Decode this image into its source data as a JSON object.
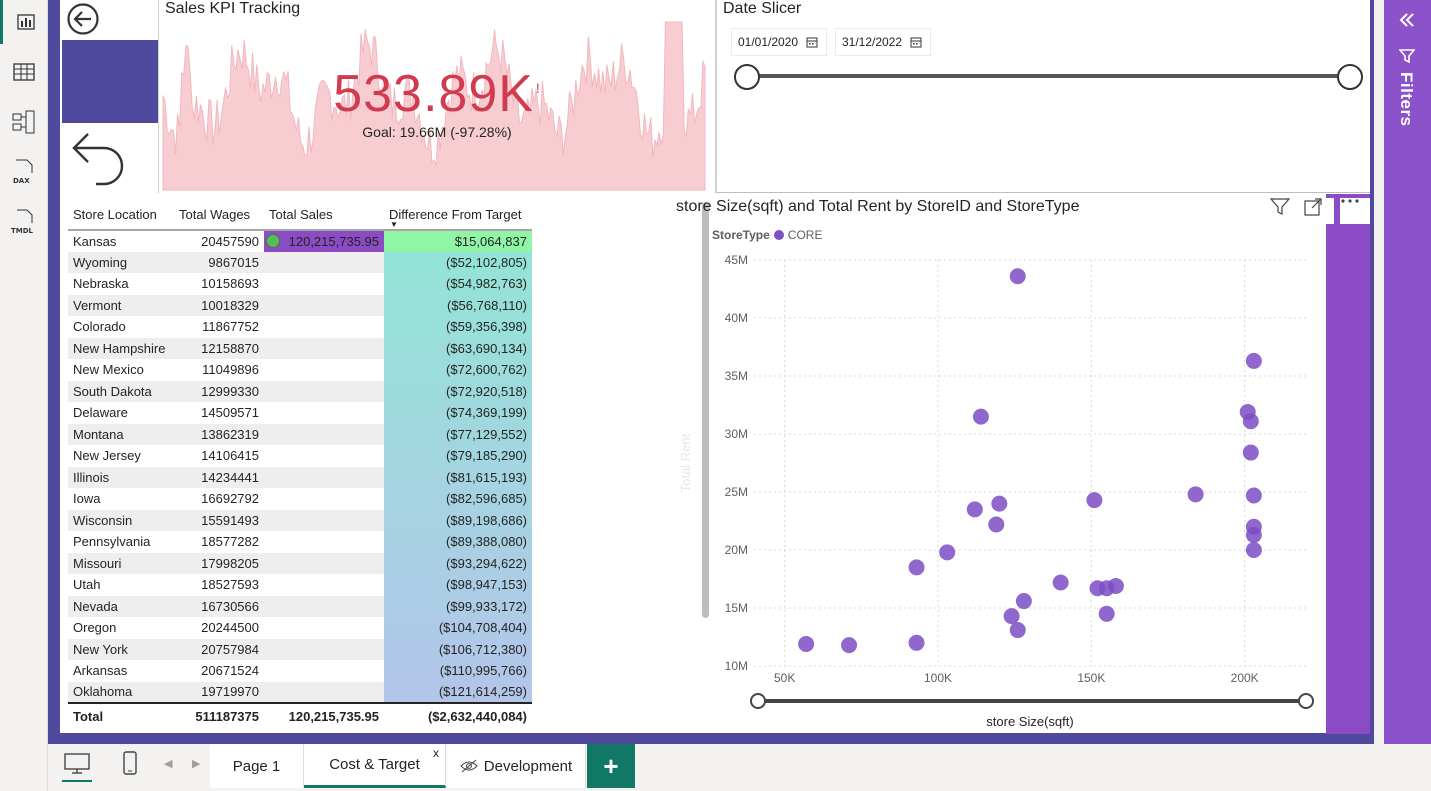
{
  "nav": {
    "left_icons": [
      "report-view-icon",
      "table-view-icon",
      "model-view-icon",
      "dax-query-icon",
      "tmdl-view-icon"
    ],
    "dax_label": "DAX",
    "tmdl_label": "TMDL"
  },
  "kpi": {
    "title": "Sales KPI Tracking",
    "value": "533.89K",
    "alert": "!",
    "goal": "Goal: 19.66M (-97.28%)",
    "value_color": "#d13b50"
  },
  "slicer": {
    "title": "Date Slicer",
    "start_date": "01/01/2020",
    "end_date": "31/12/2022"
  },
  "table": {
    "headers": [
      "Store Location",
      "Total Wages",
      "Total Sales",
      "Difference From Target"
    ],
    "rows": [
      [
        "Kansas",
        "20457590",
        "120,215,735.95",
        "$15,064,837"
      ],
      [
        "Wyoming",
        "9867015",
        "",
        "($52,102,805)"
      ],
      [
        "Nebraska",
        "10158693",
        "",
        "($54,982,763)"
      ],
      [
        "Vermont",
        "10018329",
        "",
        "($56,768,110)"
      ],
      [
        "Colorado",
        "11867752",
        "",
        "($59,356,398)"
      ],
      [
        "New Hampshire",
        "12158870",
        "",
        "($63,690,134)"
      ],
      [
        "New Mexico",
        "11049896",
        "",
        "($72,600,762)"
      ],
      [
        "South Dakota",
        "12999330",
        "",
        "($72,920,518)"
      ],
      [
        "Delaware",
        "14509571",
        "",
        "($74,369,199)"
      ],
      [
        "Montana",
        "13862319",
        "",
        "($77,129,552)"
      ],
      [
        "New Jersey",
        "14106415",
        "",
        "($79,185,290)"
      ],
      [
        "Illinois",
        "14234441",
        "",
        "($81,615,193)"
      ],
      [
        "Iowa",
        "16692792",
        "",
        "($82,596,685)"
      ],
      [
        "Wisconsin",
        "15591493",
        "",
        "($89,198,686)"
      ],
      [
        "Pennsylvania",
        "18577282",
        "",
        "($89,388,080)"
      ],
      [
        "Missouri",
        "17998205",
        "",
        "($93,294,622)"
      ],
      [
        "Utah",
        "18527593",
        "",
        "($98,947,153)"
      ],
      [
        "Nevada",
        "16730566",
        "",
        "($99,933,172)"
      ],
      [
        "Oregon",
        "20244500",
        "",
        "($104,708,404)"
      ],
      [
        "New York",
        "20757984",
        "",
        "($106,712,380)"
      ],
      [
        "Arkansas",
        "20671524",
        "",
        "($110,995,766)"
      ],
      [
        "Oklahoma",
        "19719970",
        "",
        "($121,614,259)"
      ]
    ],
    "total": [
      "Total",
      "511187375",
      "120,215,735.95",
      "($2,632,440,084)"
    ],
    "positive_color": "#90f5a6",
    "gradient_start": "#94e3d7",
    "gradient_end": "#b3c6ea",
    "bar_color": "#8a4bc4"
  },
  "scatter": {
    "title": "store Size(sqft) and Total Rent by StoreID and StoreType",
    "legend_title": "StoreType",
    "legend_item": "CORE",
    "point_color": "#7d4ec4",
    "y_axis_title": "Total Rent",
    "x_axis_title": "store Size(sqft)"
  },
  "chart_data": {
    "type": "scatter",
    "title": "store Size(sqft) and Total Rent by StoreID and StoreType",
    "xlabel": "store Size(sqft)",
    "ylabel": "Total Rent",
    "xlim": [
      40000,
      220000
    ],
    "ylim": [
      10000000,
      45000000
    ],
    "x_ticks": [
      "50K",
      "100K",
      "150K",
      "200K"
    ],
    "x_tick_values": [
      50000,
      100000,
      150000,
      200000
    ],
    "y_ticks": [
      "10M",
      "15M",
      "20M",
      "25M",
      "30M",
      "35M",
      "40M",
      "45M"
    ],
    "y_tick_values": [
      10000000,
      15000000,
      20000000,
      25000000,
      30000000,
      35000000,
      40000000,
      45000000
    ],
    "grid": true,
    "series": [
      {
        "name": "CORE",
        "points": [
          [
            57000,
            11900000
          ],
          [
            71000,
            11800000
          ],
          [
            93000,
            12000000
          ],
          [
            93000,
            18500000
          ],
          [
            103000,
            19800000
          ],
          [
            112000,
            23500000
          ],
          [
            114000,
            31500000
          ],
          [
            119000,
            22200000
          ],
          [
            120000,
            24000000
          ],
          [
            124000,
            14300000
          ],
          [
            126000,
            13100000
          ],
          [
            126000,
            43600000
          ],
          [
            128000,
            15600000
          ],
          [
            140000,
            17200000
          ],
          [
            151000,
            24300000
          ],
          [
            152000,
            16700000
          ],
          [
            155000,
            16700000
          ],
          [
            155000,
            14500000
          ],
          [
            158000,
            16900000
          ],
          [
            184000,
            24800000
          ],
          [
            201000,
            31900000
          ],
          [
            202000,
            31100000
          ],
          [
            202000,
            28400000
          ],
          [
            203000,
            36300000
          ],
          [
            203000,
            20000000
          ],
          [
            203000,
            24700000
          ],
          [
            203000,
            22000000
          ],
          [
            203000,
            21300000
          ]
        ]
      }
    ]
  },
  "pages": {
    "tabs": [
      "Page 1",
      "Cost & Target",
      "Development"
    ],
    "close_label": "x",
    "add_label": "+"
  },
  "filters_label": "Filters"
}
